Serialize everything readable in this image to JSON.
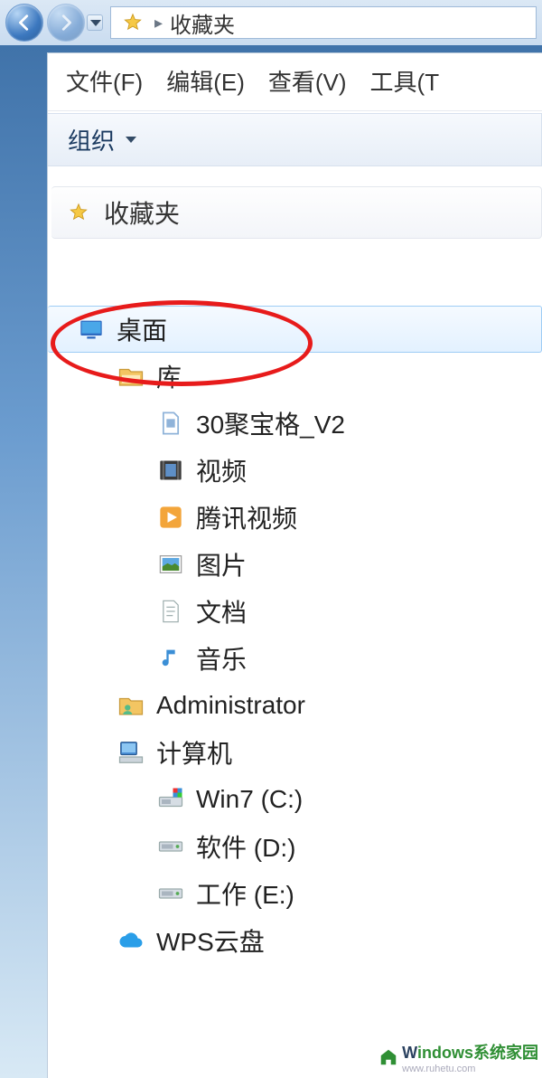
{
  "nav": {
    "breadcrumb": "收藏夹"
  },
  "menubar": {
    "file": "文件(F)",
    "edit": "编辑(E)",
    "view": "查看(V)",
    "tools": "工具(T"
  },
  "toolbar": {
    "organize": "组织"
  },
  "favorites": {
    "label": "收藏夹"
  },
  "tree": {
    "desktop": "桌面",
    "libraries": "库",
    "items": [
      {
        "label": "30聚宝格_V2"
      },
      {
        "label": "视频"
      },
      {
        "label": "腾讯视频"
      },
      {
        "label": "图片"
      },
      {
        "label": "文档"
      },
      {
        "label": "音乐"
      }
    ],
    "admin": "Administrator",
    "computer": "计算机",
    "drives": [
      {
        "label": "Win7 (C:)"
      },
      {
        "label": "软件 (D:)"
      },
      {
        "label": "工作 (E:)"
      }
    ],
    "cloud": "WPS云盘"
  },
  "watermark": {
    "part1": "W",
    "part2": "indows系统家园",
    "url": "www.ruhetu.com"
  }
}
